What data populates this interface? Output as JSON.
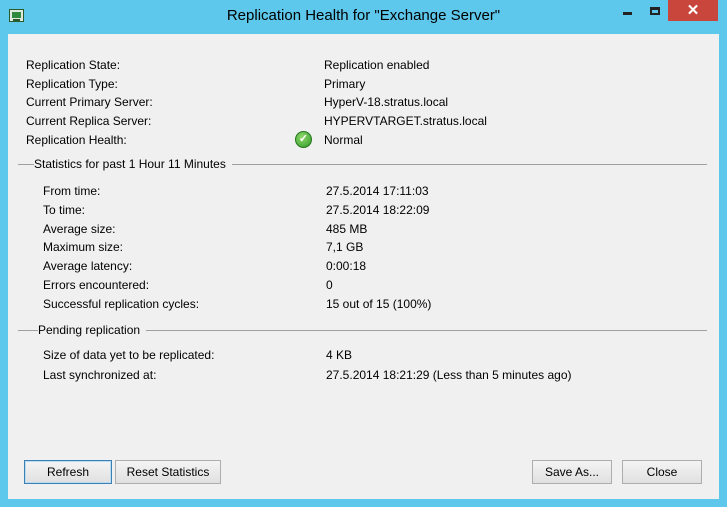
{
  "window": {
    "title": "Replication Health for \"Exchange Server\""
  },
  "titlebar_buttons": {
    "minimize": "minimize",
    "maximize": "maximize",
    "close": "✕"
  },
  "info": {
    "state_label": "Replication State:",
    "state_value": "Replication enabled",
    "type_label": "Replication Type:",
    "type_value": "Primary",
    "primary_label": "Current Primary Server:",
    "primary_value": "HyperV-18.stratus.local",
    "replica_label": "Current Replica Server:",
    "replica_value": "HYPERVTARGET.stratus.local",
    "health_label": "Replication Health:",
    "health_value": "Normal",
    "health_icon": "check-circle-green"
  },
  "statistics": {
    "heading": "Statistics for past 1 Hour 11 Minutes",
    "rows": [
      {
        "label": "From time:",
        "value": "27.5.2014 17:11:03"
      },
      {
        "label": "To time:",
        "value": "27.5.2014 18:22:09"
      },
      {
        "label": "Average size:",
        "value": "485 MB"
      },
      {
        "label": "Maximum size:",
        "value": "7,1 GB"
      },
      {
        "label": "Average latency:",
        "value": "0:00:18"
      },
      {
        "label": "Errors encountered:",
        "value": "0"
      },
      {
        "label": "Successful replication cycles:",
        "value": "15 out of 15 (100%)"
      }
    ]
  },
  "pending": {
    "heading": "Pending replication",
    "rows": [
      {
        "label": "Size of data yet to be replicated:",
        "value": "4 KB"
      },
      {
        "label": "Last synchronized at:",
        "value": "27.5.2014 18:21:29 (Less than 5 minutes ago)"
      }
    ]
  },
  "buttons": {
    "refresh": "Refresh",
    "reset": "Reset Statistics",
    "save_as": "Save As...",
    "close": "Close"
  },
  "colors": {
    "frame": "#5ec8ec",
    "close_button": "#c9463d",
    "client": "#f0f0f0",
    "health_ok": "#2f9a2a"
  }
}
